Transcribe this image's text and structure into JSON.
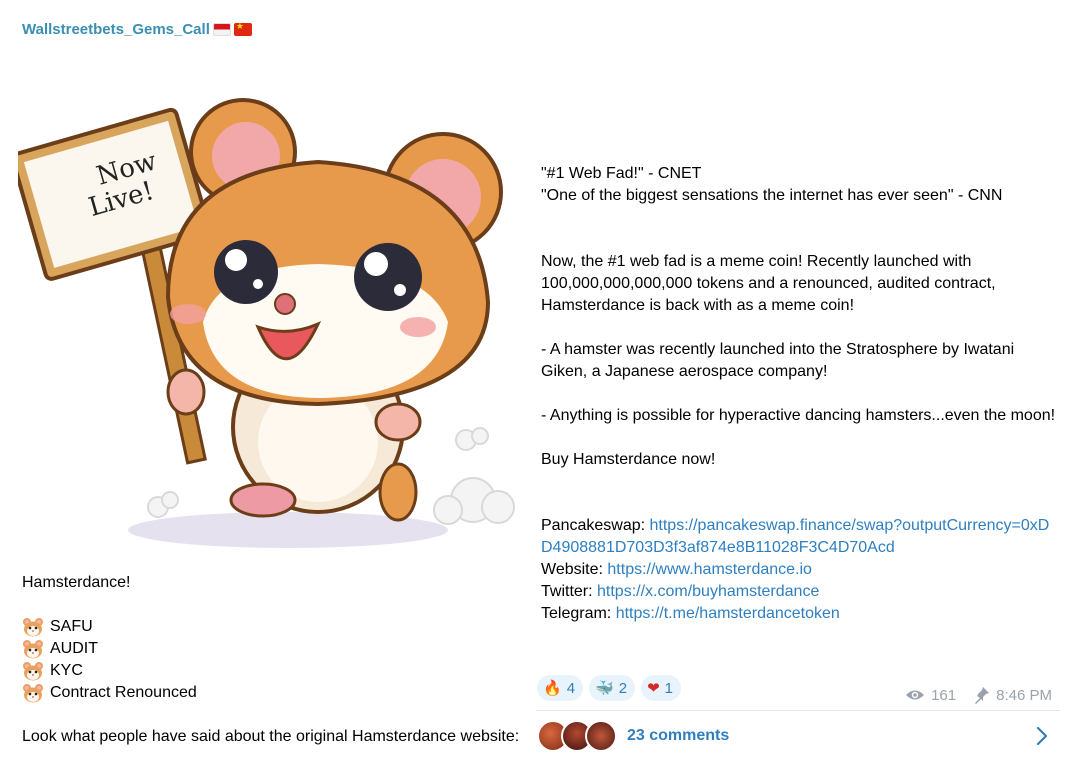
{
  "channel": {
    "name": "Wallstreetbets_Gems_Call",
    "flags": [
      "flag-indonesia",
      "flag-china"
    ]
  },
  "image": {
    "sign_text_line1": "Now",
    "sign_text_line2": "Live!"
  },
  "left_text": {
    "intro": "Hamsterdance!",
    "features": [
      "SAFU",
      "AUDIT",
      "KYC",
      "Contract Renounced"
    ],
    "look": "Look what people have said about the original Hamsterdance website:"
  },
  "right_text": {
    "quote1": "\"#1 Web Fad!\" - CNET",
    "quote2": "\"One of the biggest sensations the internet has ever seen\" - CNN",
    "para1": "Now, the #1 web fad is a meme coin!  Recently launched with 100,000,000,000,000 tokens and a renounced, audited contract, Hamsterdance is back with as a meme coin!",
    "para2": "- A hamster was recently launched into the Stratosphere by Iwatani Giken, a Japanese aerospace company!",
    "para3": "- Anything is possible for hyperactive dancing hamsters...even the moon!",
    "cta": "Buy Hamsterdance now!",
    "links": [
      {
        "label": "Pancakeswap: ",
        "url": "https://pancakeswap.finance/swap?outputCurrency=0xDD4908881D703D3f3af874e8B11028F3C4D70Acd"
      },
      {
        "label": "Website: ",
        "url": "https://www.hamsterdance.io"
      },
      {
        "label": "Twitter: ",
        "url": "https://x.com/buyhamsterdance"
      },
      {
        "label": "Telegram: ",
        "url": "https://t.me/hamsterdancetoken"
      }
    ]
  },
  "reactions": [
    {
      "emoji": "🔥",
      "icon": "fire-icon",
      "count": "4"
    },
    {
      "emoji": "🐳",
      "icon": "whale-icon",
      "count": "2"
    },
    {
      "emoji": "❤",
      "icon": "heart-icon",
      "count": "1"
    }
  ],
  "meta": {
    "views": "161",
    "time": "8:46 PM"
  },
  "comments": {
    "label": "23 comments"
  },
  "colors": {
    "link": "#2e7fc1",
    "channel": "#3a8fb2",
    "reaction_bg": "#e9f3fb",
    "meta": "#9aa3ac"
  }
}
